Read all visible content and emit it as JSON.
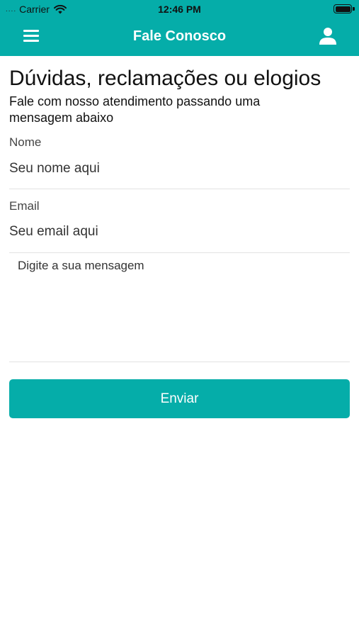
{
  "status_bar": {
    "signal": "....",
    "carrier": "Carrier",
    "time": "12:46 PM"
  },
  "header": {
    "title": "Fale Conosco",
    "menu_icon": "hamburger-menu-icon",
    "user_icon": "user-profile-icon",
    "background_color": "#05ADA9"
  },
  "page": {
    "heading": "Dúvidas, reclamações ou elogios",
    "subheading": "Fale com nosso atendimento passando uma mensagem abaixo"
  },
  "form": {
    "name_label": "Nome",
    "name_placeholder": "Seu nome aqui",
    "email_label": "Email",
    "email_placeholder": "Seu email aqui",
    "message_placeholder": "Digite a sua mensagem",
    "submit_label": "Enviar"
  }
}
